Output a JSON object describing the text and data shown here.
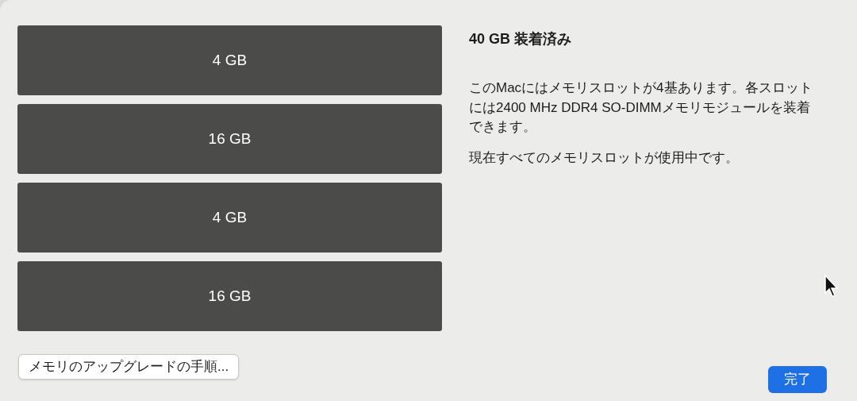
{
  "slots": [
    {
      "label": "4 GB"
    },
    {
      "label": "16 GB"
    },
    {
      "label": "4 GB"
    },
    {
      "label": "16 GB"
    }
  ],
  "summary": {
    "title": "40 GB 装着済み",
    "paragraphs": [
      "このMacにはメモリスロットが4基あります。各スロットには2400 MHz DDR4 SO-DIMMメモリモジュールを装着できます。",
      "現在すべてのメモリスロットが使用中です。"
    ]
  },
  "buttons": [
    {
      "label": "メモリのアップグレードの手順...",
      "kind": "secondary"
    },
    {
      "label": "完了",
      "kind": "primary"
    }
  ]
}
